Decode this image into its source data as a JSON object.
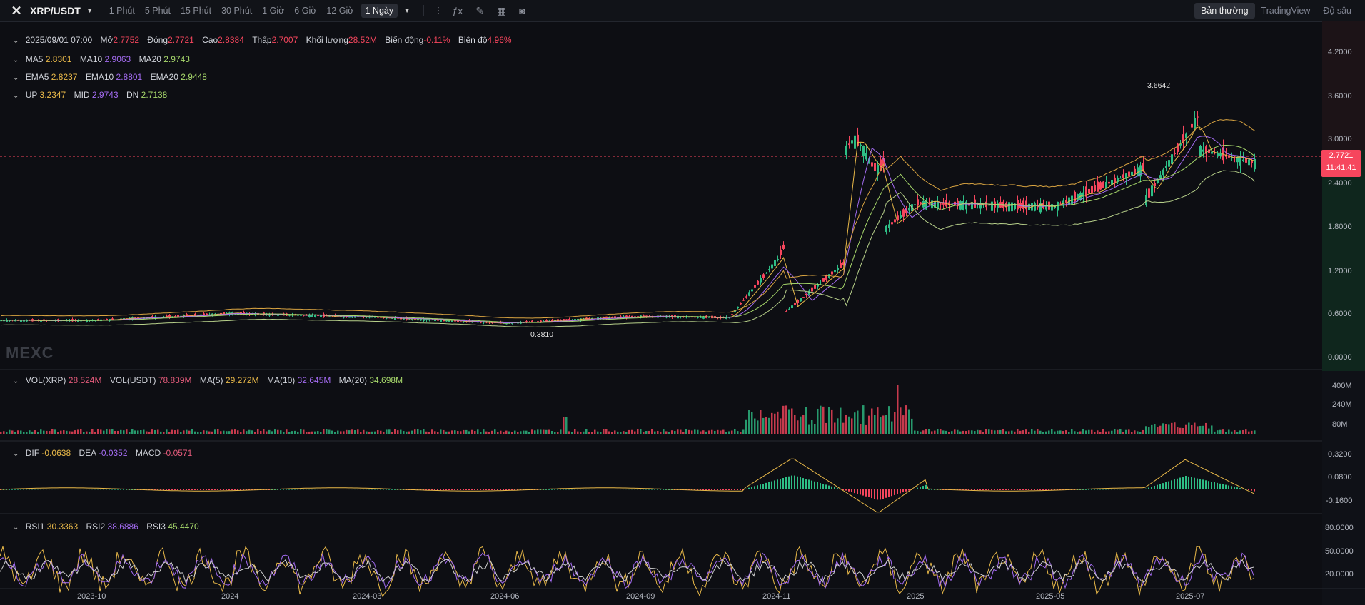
{
  "toolbar": {
    "symbol": "XRP/USDT",
    "intervals": [
      "1 Phút",
      "5 Phút",
      "15 Phút",
      "30 Phút",
      "1 Giờ",
      "6 Giờ",
      "12 Giờ"
    ],
    "active_interval": "1 Ngày",
    "views": [
      "Bản thường",
      "TradingView",
      "Độ sâu"
    ],
    "tools": [
      "candle-type-icon",
      "indicator-icon",
      "draw-icon",
      "layout-icon",
      "camera-icon"
    ]
  },
  "ohlc": {
    "date": "2025/09/01 07:00",
    "open_label": "Mở",
    "open": "2.7752",
    "close_label": "Đóng",
    "close": "2.7721",
    "high_label": "Cao",
    "high": "2.8384",
    "low_label": "Thấp",
    "low": "2.7007",
    "volume_label": "Khối lượng",
    "volume": "28.52M",
    "change_label": "Biến động",
    "change": "-0.11%",
    "amplitude_label": "Biên độ",
    "amplitude": "4.96%"
  },
  "ma": {
    "ma5_label": "MA5",
    "ma5": "2.8301",
    "ma10_label": "MA10",
    "ma10": "2.9063",
    "ma20_label": "MA20",
    "ma20": "2.9743"
  },
  "ema": {
    "ema5_label": "EMA5",
    "ema5": "2.8237",
    "ema10_label": "EMA10",
    "ema10": "2.8801",
    "ema20_label": "EMA20",
    "ema20": "2.9448"
  },
  "boll": {
    "up_label": "UP",
    "up": "3.2347",
    "mid_label": "MID",
    "mid": "2.9743",
    "dn_label": "DN",
    "dn": "2.7138"
  },
  "vol": {
    "xrp_label": "VOL(XRP)",
    "xrp": "28.524M",
    "usdt_label": "VOL(USDT)",
    "usdt": "78.839M",
    "ma5_label": "MA(5)",
    "ma5": "29.272M",
    "ma10_label": "MA(10)",
    "ma10": "32.645M",
    "ma20_label": "MA(20)",
    "ma20": "34.698M"
  },
  "macd": {
    "dif_label": "DIF",
    "dif": "-0.0638",
    "dea_label": "DEA",
    "dea": "-0.0352",
    "macd_label": "MACD",
    "macd": "-0.0571"
  },
  "rsi": {
    "rsi1_label": "RSI1",
    "rsi1": "30.3363",
    "rsi2_label": "RSI2",
    "rsi2": "38.6886",
    "rsi3_label": "RSI3",
    "rsi3": "45.4470"
  },
  "price_axis": [
    "4.2000",
    "3.6000",
    "3.0000",
    "2.4000",
    "1.8000",
    "1.2000",
    "0.6000",
    "0.0000"
  ],
  "vol_axis": [
    "400M",
    "240M",
    "80M"
  ],
  "macd_axis": [
    "0.3200",
    "0.0800",
    "-0.1600"
  ],
  "rsi_axis": [
    "80.0000",
    "50.0000",
    "20.0000"
  ],
  "x_axis": [
    "2023-10",
    "2024",
    "2024-03",
    "2024-06",
    "2024-09",
    "2024-11",
    "2025",
    "2025-05",
    "2025-07"
  ],
  "current_price": "2.7721",
  "countdown": "11:41:41",
  "high_annotation": "3.6642",
  "low_annotation": "0.3810",
  "watermark": "MEXC",
  "colors": {
    "up": "#2ebd85",
    "down": "#f6465d",
    "ma5": "#e9b949",
    "ma10": "#a46cf2",
    "ma20": "#a7d86b",
    "bg": "#0d0e13"
  },
  "chart_data": {
    "type": "line",
    "title": "",
    "x": [
      "2023-10",
      "2024",
      "2024-03",
      "2024-06",
      "2024-09",
      "2024-11",
      "2025",
      "2025-05",
      "2025-07"
    ],
    "series": [
      {
        "name": "",
        "values": [
          0.52,
          0.62,
          0.57,
          0.48,
          0.58,
          0.55,
          2.2,
          2.15,
          3.0
        ]
      }
    ],
    "ylim": [
      0,
      4.5
    ]
  }
}
